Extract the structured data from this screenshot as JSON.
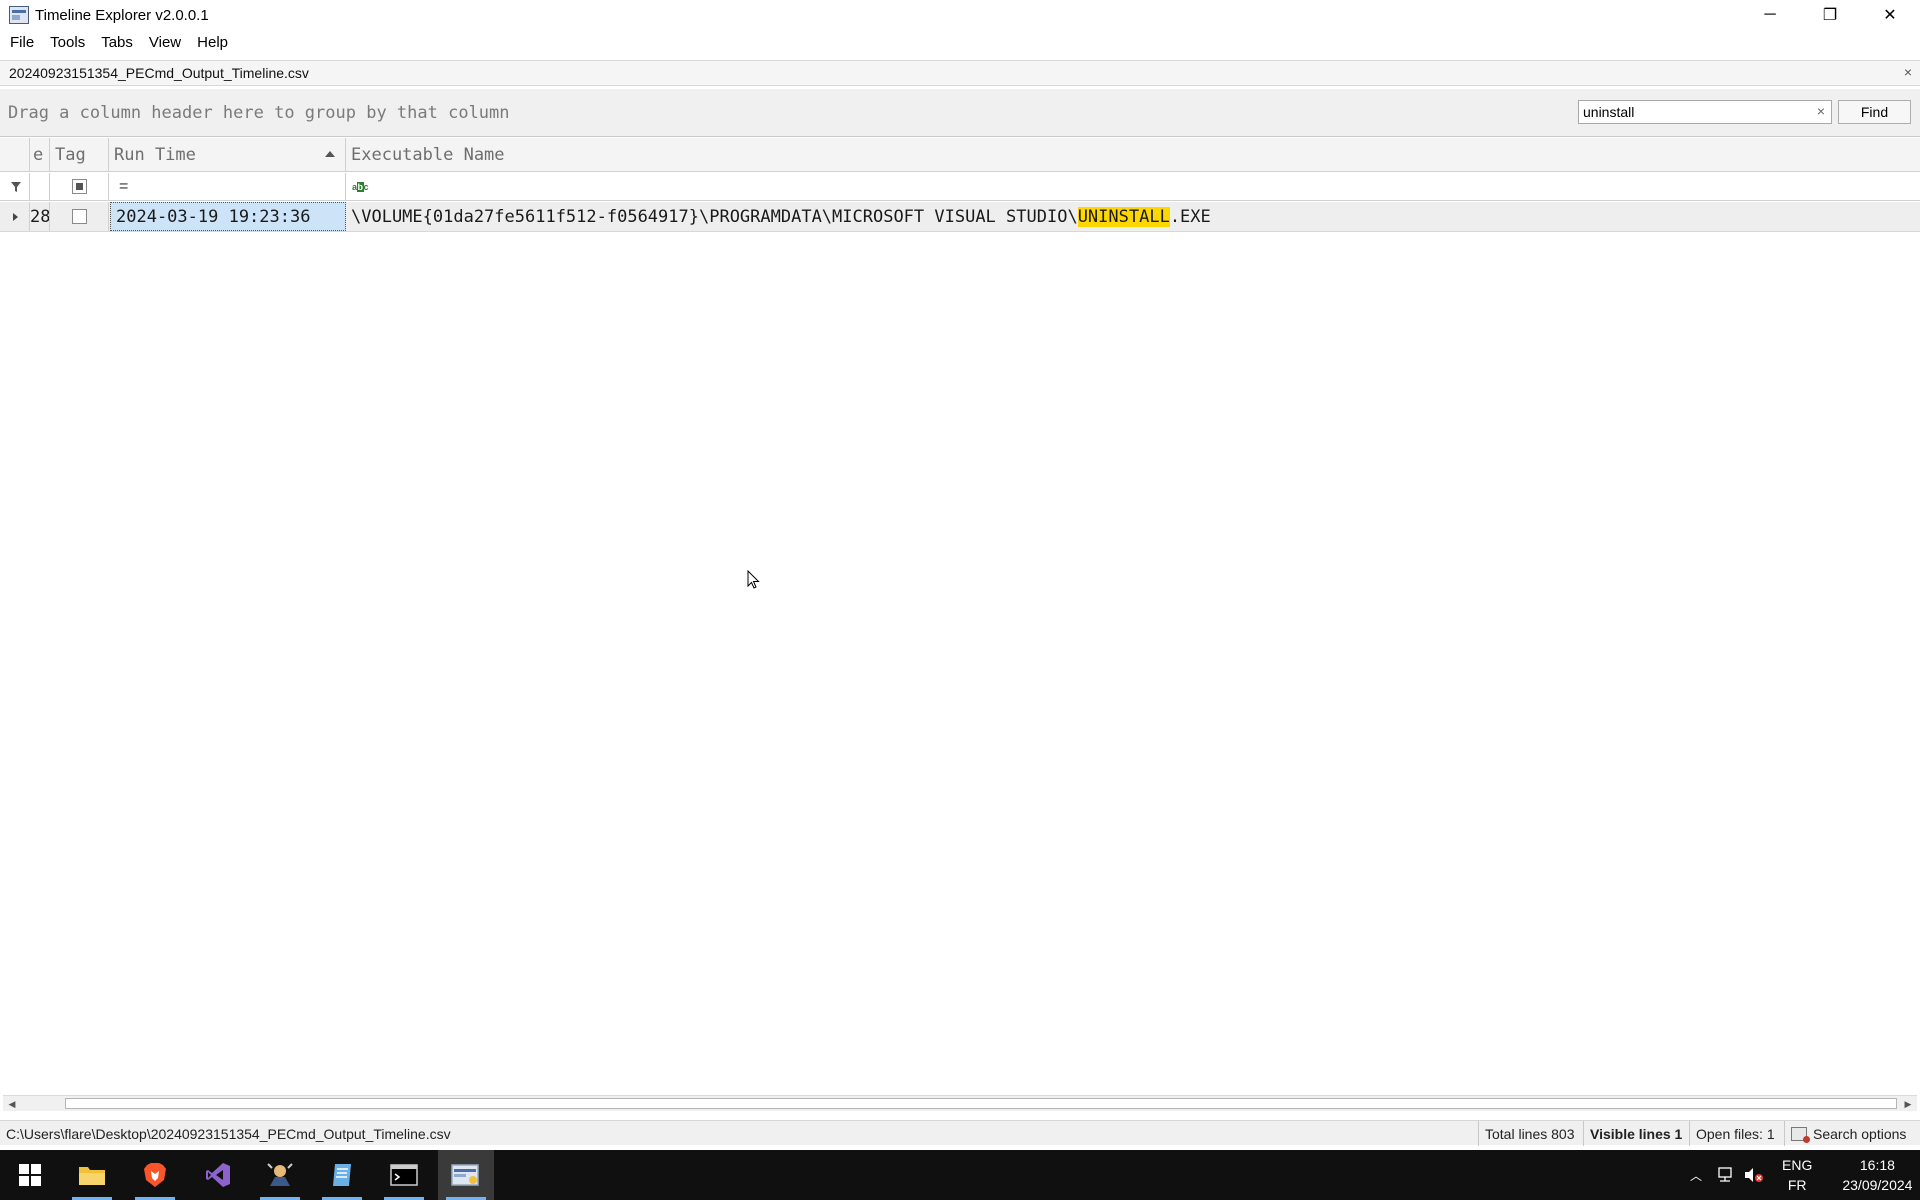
{
  "window": {
    "title": "Timeline Explorer v2.0.0.1",
    "minimize_glyph": "─",
    "restore_glyph": "❐",
    "close_glyph": "✕"
  },
  "menu": [
    "File",
    "Tools",
    "Tabs",
    "View",
    "Help"
  ],
  "document_tab": {
    "label": "20240923151354_PECmd_Output_Timeline.csv",
    "close_glyph": "×"
  },
  "group_panel": {
    "hint": "Drag a column header here to group by that column"
  },
  "search": {
    "value": "uninstall",
    "clear_glyph": "×",
    "find_label": "Find"
  },
  "grid": {
    "columns": [
      {
        "label": "e"
      },
      {
        "label": "Tag"
      },
      {
        "label": "Run Time",
        "sorted": "ascending"
      },
      {
        "label": "Executable Name"
      }
    ],
    "filter_row": {
      "runtime_operator": "=",
      "exe_icon": "abc-filter-icon"
    },
    "rows": [
      {
        "line_fragment": "28",
        "tag_checked": false,
        "run_time": "2024-03-19 19:23:36",
        "exe_prefix": "\\VOLUME{01da27fe5611f512-f0564917}\\PROGRAMDATA\\MICROSOFT VISUAL STUDIO\\",
        "exe_match": "UNINSTALL",
        "exe_suffix": ".EXE"
      }
    ]
  },
  "status_bar": {
    "path": "C:\\Users\\flare\\Desktop\\20240923151354_PECmd_Output_Timeline.csv",
    "total_lines": "Total lines 803",
    "visible_lines": "Visible lines 1",
    "open_files": "Open files: 1",
    "search_options": "Search options"
  },
  "taskbar": {
    "apps": [
      "start-icon",
      "file-explorer-icon",
      "brave-browser-icon",
      "visual-studio-icon",
      "ida-icon",
      "notepad-icon",
      "terminal-icon",
      "timeline-explorer-icon"
    ],
    "lang_top": "ENG",
    "lang_bottom": "FR",
    "time": "16:18",
    "date": "23/09/2024"
  },
  "colors": {
    "highlight": "#ffd700",
    "selected_cell": "#cde3f7",
    "taskbar": "#101010",
    "accent": "#6fb3f2"
  }
}
